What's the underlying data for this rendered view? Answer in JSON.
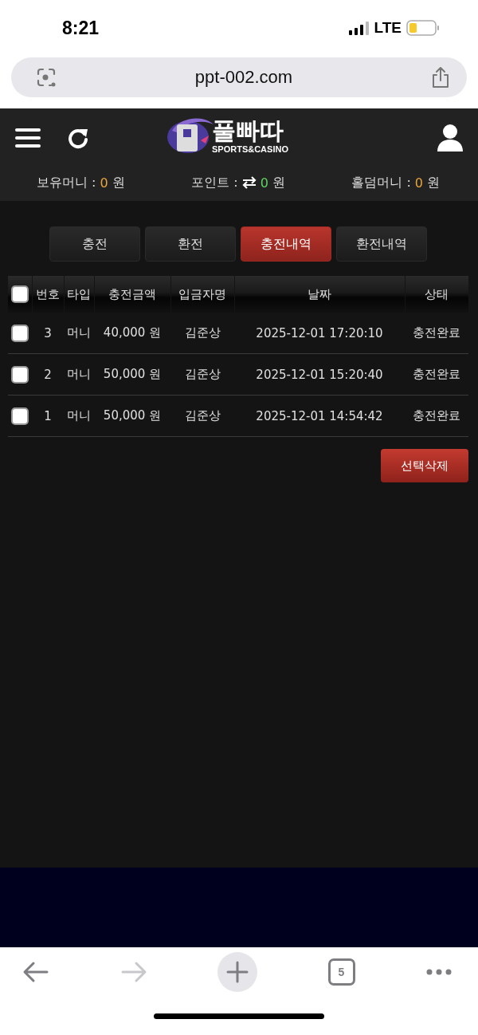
{
  "status_bar": {
    "time": "8:21",
    "network": "LTE"
  },
  "address_bar": {
    "url": "ppt-002.com"
  },
  "header": {
    "logo_title": "풀빠따",
    "logo_subtitle": "SPORTS&CASINO"
  },
  "balances": [
    {
      "kind": "plain",
      "label": "보유머니 :",
      "value": "0",
      "unit": "원",
      "color": "#e8a33a"
    },
    {
      "kind": "exchange",
      "label": "포인트 :",
      "value": "0",
      "unit": "원",
      "color": "#5fd35f"
    },
    {
      "kind": "plain",
      "label": "홀덤머니 :",
      "value": "0",
      "unit": "원",
      "color": "#e8a33a"
    }
  ],
  "tabs": [
    {
      "label": "충전",
      "selected": false
    },
    {
      "label": "환전",
      "selected": false
    },
    {
      "label": "충전내역",
      "selected": true
    },
    {
      "label": "환전내역",
      "selected": false
    }
  ],
  "table": {
    "select_all_checked": false,
    "columns": [
      "번호",
      "타입",
      "충전금액",
      "입금자명",
      "날짜",
      "상태"
    ],
    "rows": [
      {
        "checked": false,
        "cells": [
          "3",
          "머니",
          "40,000 원",
          "김준상",
          "2025-12-01 17:20:10",
          "충전완료"
        ]
      },
      {
        "checked": false,
        "cells": [
          "2",
          "머니",
          "50,000 원",
          "김준상",
          "2025-12-01 15:20:40",
          "충전완료"
        ]
      },
      {
        "checked": false,
        "cells": [
          "1",
          "머니",
          "50,000 원",
          "김준상",
          "2025-12-01 14:54:42",
          "충전완료"
        ]
      }
    ]
  },
  "delete_button": "선택삭제",
  "browser_toolbar": {
    "forward_disabled": true,
    "tab_count": "5"
  }
}
